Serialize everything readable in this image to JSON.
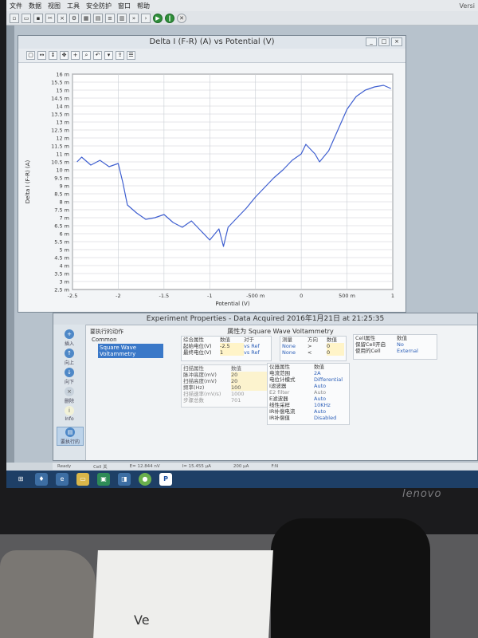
{
  "menu": {
    "items": [
      "文件",
      "数据",
      "视图",
      "工具",
      "安全防护",
      "窗口",
      "帮助"
    ],
    "right_text": "Versi"
  },
  "chart_window": {
    "title": "Delta I (F-R) (A) vs Potential (V)",
    "controls": [
      "_",
      "□",
      "×"
    ]
  },
  "chart_data": {
    "type": "line",
    "title": "Delta I (F-R) (A) vs Potential (V)",
    "xlabel": "Potential (V)",
    "ylabel": "Delta I (F-R) (A)",
    "xlim": [
      -2.5,
      1.0
    ],
    "ylim": [
      2.5,
      16.0
    ],
    "x_tick_labels": [
      "-2.5",
      "-2",
      "-1.5",
      "-1",
      "-500 m",
      "0",
      "500 m",
      "1"
    ],
    "x_tick_values": [
      -2.5,
      -2,
      -1.5,
      -1,
      -0.5,
      0,
      0.5,
      1
    ],
    "y_tick_labels": [
      "16 m",
      "15.5 m",
      "15 m",
      "14.5 m",
      "14 m",
      "13.5 m",
      "13 m",
      "12.5 m",
      "12 m",
      "11.5 m",
      "11 m",
      "10.5 m",
      "10 m",
      "9.5 m",
      "9 m",
      "8.5 m",
      "8 m",
      "7.5 m",
      "7 m",
      "6.5 m",
      "6 m",
      "5.5 m",
      "5 m",
      "4.5 m",
      "4 m",
      "3.5 m",
      "3 m",
      "2.5 m"
    ],
    "y_tick_values": [
      16,
      15.5,
      15,
      14.5,
      14,
      13.5,
      13,
      12.5,
      12,
      11.5,
      11,
      10.5,
      10,
      9.5,
      9,
      8.5,
      8,
      7.5,
      7,
      6.5,
      6,
      5.5,
      5,
      4.5,
      4,
      3.5,
      3,
      2.5
    ],
    "grid": true,
    "series": [
      {
        "color": "#3f5fd0",
        "x": [
          -2.45,
          -2.4,
          -2.3,
          -2.2,
          -2.1,
          -2.0,
          -1.95,
          -1.9,
          -1.8,
          -1.7,
          -1.6,
          -1.5,
          -1.4,
          -1.3,
          -1.2,
          -1.1,
          -1.0,
          -0.9,
          -0.85,
          -0.8,
          -0.7,
          -0.6,
          -0.5,
          -0.4,
          -0.3,
          -0.2,
          -0.1,
          0.0,
          0.05,
          0.1,
          0.15,
          0.2,
          0.3,
          0.4,
          0.5,
          0.6,
          0.7,
          0.8,
          0.9,
          0.98
        ],
        "y": [
          10.5,
          10.8,
          10.3,
          10.6,
          10.2,
          10.4,
          9.2,
          7.8,
          7.3,
          6.9,
          7.0,
          7.2,
          6.7,
          6.4,
          6.8,
          6.2,
          5.6,
          6.3,
          5.2,
          6.4,
          7.0,
          7.6,
          8.3,
          8.9,
          9.5,
          10.0,
          10.6,
          11.0,
          11.6,
          11.3,
          11.0,
          10.5,
          11.2,
          12.5,
          13.8,
          14.6,
          15.0,
          15.2,
          15.3,
          15.1
        ]
      }
    ]
  },
  "props_window": {
    "title": "Experiment Properties - Data Acquired 2016年1月21日 at 21:25:35",
    "method_title": "属性为 Square Wave Voltammetry",
    "steps_header": "要执行的动作",
    "steps_common": "Common",
    "steps_selected": "Square Wave Voltammetry",
    "nav": [
      "插入",
      "向上",
      "向下",
      "删除",
      "Info",
      "要执行的"
    ],
    "potential_table": {
      "headers": [
        "综合属性",
        "数值",
        "对于"
      ],
      "rows": [
        [
          "起始电位(V)",
          "-2.5",
          "vs Ref"
        ],
        [
          "最终电位(V)",
          "1",
          "vs Ref"
        ]
      ]
    },
    "scan_table": {
      "headers": [
        "扫描属性",
        "数值"
      ],
      "rows": [
        [
          "脉冲高度(mV)",
          "20"
        ],
        [
          "扫描高度(mV)",
          "20"
        ],
        [
          "频率(Hz)",
          "100"
        ],
        [
          "扫描速率(mV/s)",
          "1000"
        ],
        [
          "步骤总数",
          "701"
        ]
      ]
    },
    "switch_table": {
      "headers": [
        "测量",
        "方向",
        "数值"
      ],
      "rows": [
        [
          "None",
          ">",
          "0"
        ],
        [
          "None",
          "<",
          "0"
        ]
      ]
    },
    "instrument_table": {
      "headers": [
        "仪器属性",
        "数值"
      ],
      "rows": [
        [
          "电流范围",
          "2A"
        ],
        [
          "电位计模式",
          "Differential"
        ],
        [
          "I滤波器",
          "Auto"
        ],
        [
          "E2 filter",
          "Auto"
        ],
        [
          "E滤波器",
          "Auto"
        ],
        [
          "线性采样",
          "10KHz"
        ],
        [
          "IR补偿电流",
          "Auto"
        ],
        [
          "IR补偿值",
          "Disabled"
        ]
      ]
    },
    "cell_table": {
      "headers": [
        "Cell属性",
        "数值"
      ],
      "rows": [
        [
          "保留Cell开启",
          "No"
        ],
        [
          "使用的Cell",
          "External"
        ]
      ]
    }
  },
  "statusbar": {
    "items": [
      "Ready",
      "Cell 关",
      "E= 12.844 nV",
      "I= 15.455 μA",
      "200 μA",
      "F:N"
    ]
  },
  "brand": "lenovo",
  "paper_text": "Ve"
}
